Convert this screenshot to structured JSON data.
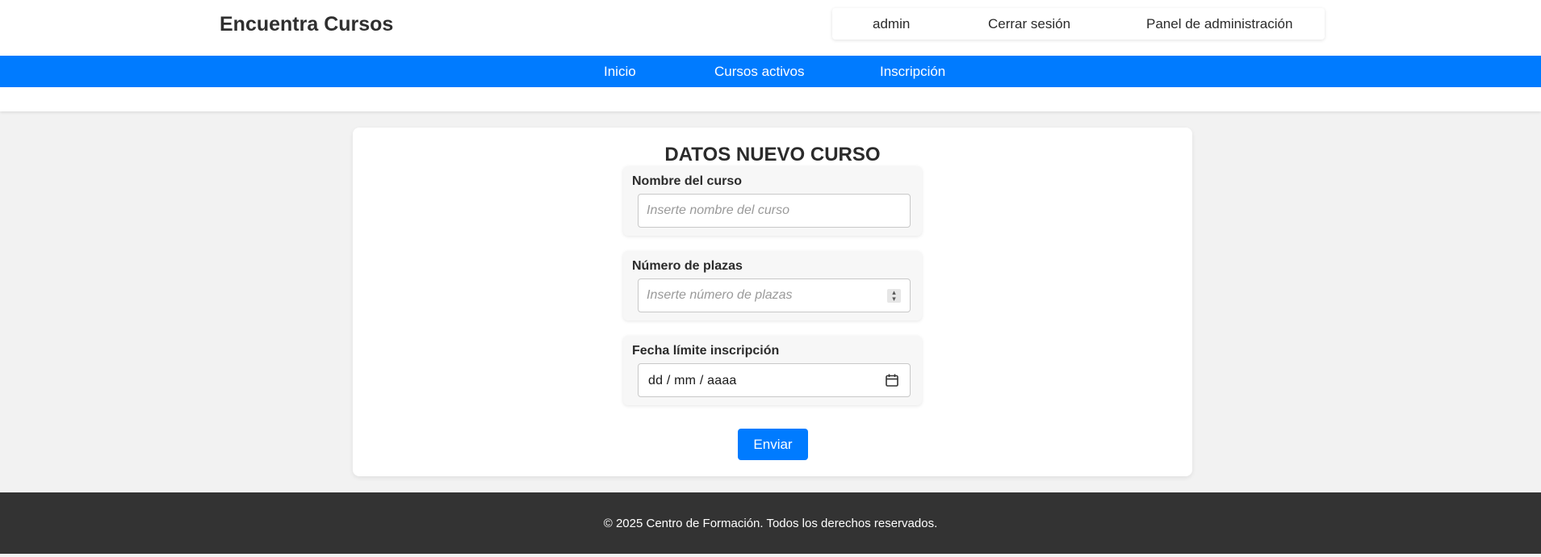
{
  "header": {
    "brand": "Encuentra Cursos",
    "user_menu": {
      "user": "admin",
      "logout": "Cerrar sesión",
      "admin_panel": "Panel de administración"
    }
  },
  "nav": {
    "items": [
      "Inicio",
      "Cursos activos",
      "Inscripción"
    ]
  },
  "form": {
    "title": "DATOS NUEVO CURSO",
    "fields": [
      {
        "label": "Nombre del curso",
        "placeholder": "Inserte nombre del curso",
        "type": "text"
      },
      {
        "label": "Número de plazas",
        "placeholder": "Inserte número de plazas",
        "type": "number"
      },
      {
        "label": "Fecha límite inscripción",
        "value_display": "dd / mm / aaaa",
        "type": "date"
      }
    ],
    "submit_label": "Enviar"
  },
  "footer": {
    "text": "© 2025 Centro de Formación. Todos los derechos reservados."
  },
  "colors": {
    "accent": "#007bff",
    "footer_bg": "#333333",
    "page_bg": "#f2f2f2"
  },
  "icons": {
    "date_field": "calendar-icon",
    "number_field": "spinner-arrows-icon"
  }
}
